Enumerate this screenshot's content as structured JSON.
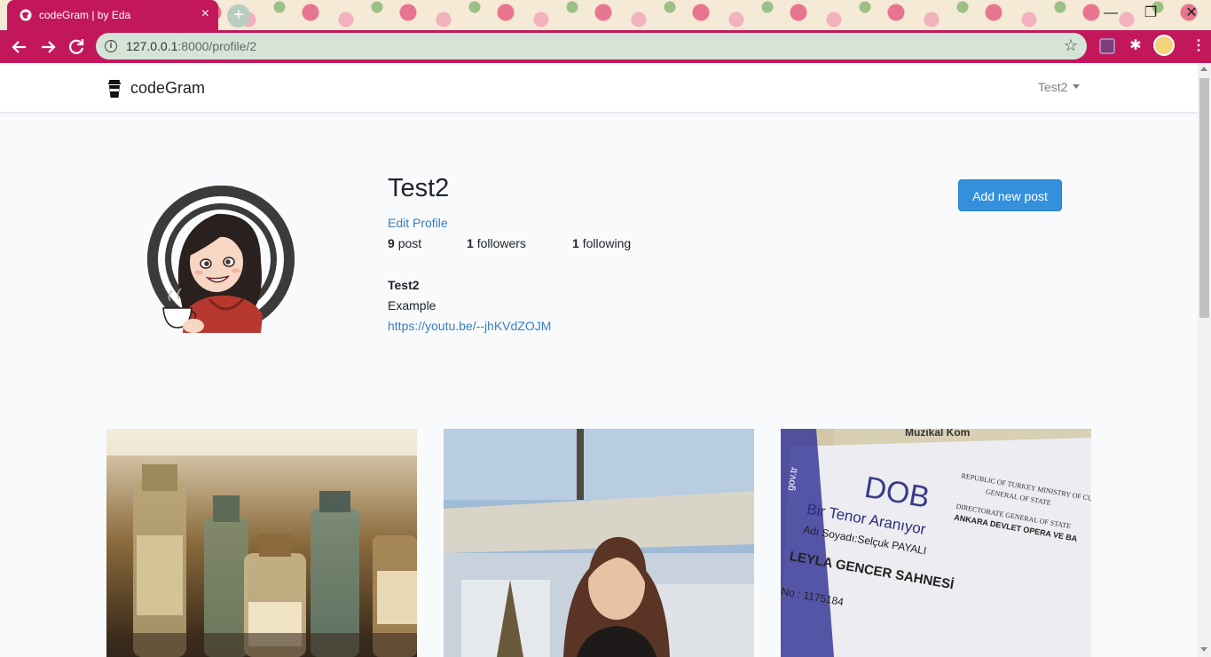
{
  "browser": {
    "tab_title": "codeGram | by Eda",
    "tab_close": "×",
    "new_tab": "+",
    "url_host": "127.0.0.1",
    "url_path": ":8000/profile/2",
    "min_label": "—",
    "restore_label": "❐",
    "close_label": "✕",
    "star": "☆",
    "info": "i",
    "puzzle": "✱",
    "menu": "⋮"
  },
  "navbar": {
    "brand": "codeGram",
    "user": "Test2"
  },
  "profile": {
    "username": "Test2",
    "edit_link": "Edit Profile",
    "posts_count": "9",
    "posts_label": "post",
    "followers_count": "1",
    "followers_label": "followers",
    "following_count": "1",
    "following_label": "following",
    "bio_title": "Test2",
    "bio_description": "Example",
    "bio_url": "https://youtu.be/--jhKVdZOJM",
    "add_post_button": "Add new post"
  },
  "posts": {
    "thumb3_text1": "Muzikal Kom",
    "thumb3_logo": "DOB",
    "thumb3_side": "gov.tr",
    "thumb3_ministry": "REPUBLIC OF TURKEY MINISTRY OF CU",
    "thumb3_general": "GENERAL OF STATE",
    "thumb3_directorate": "DIRECTORATE GENERAL OF STATE",
    "thumb3_ankara": "ANKARA DEVLET OPERA VE BA",
    "thumb3_tenor": "Bir Tenor Aranıyor",
    "thumb3_name": "Adı Soyadı:Selçuk PAYALI",
    "thumb3_stage": "LEYLA GENCER SAHNESİ",
    "thumb3_no": "ezNo : 1175184"
  },
  "colors": {
    "browser_accent": "#c2185b",
    "primary_button": "#3490dc",
    "link": "#3a7dc0"
  }
}
